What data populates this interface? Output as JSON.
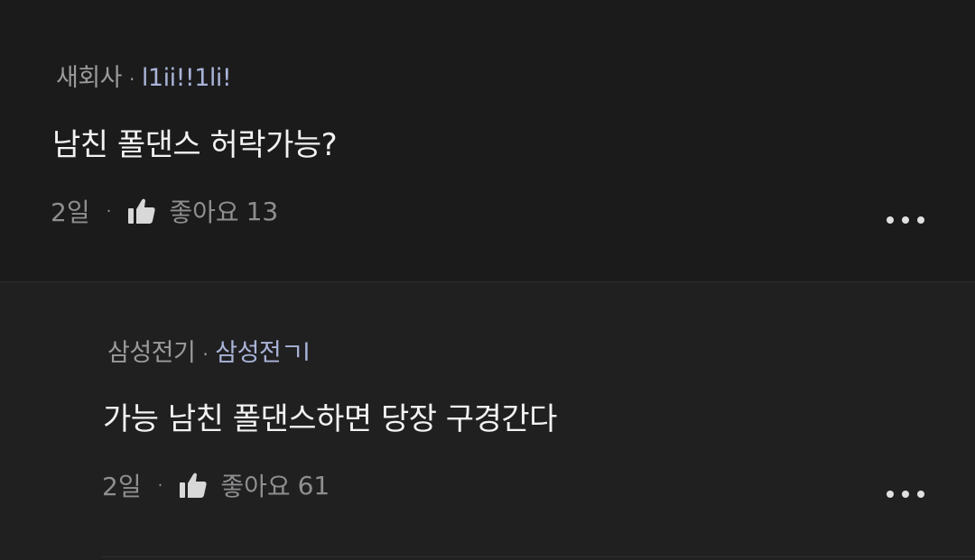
{
  "comments": [
    {
      "company": "새회사",
      "nickname": "l1ii!!1li!",
      "text": "남친 폴댄스 허락가능?",
      "time": "2일",
      "like_label": "좋아요",
      "like_count": "13"
    },
    {
      "company": "삼성전기",
      "nickname": "삼성전ㄱl",
      "text": "가능 남친 폴댄스하면 당장 구경간다",
      "time": "2일",
      "like_label": "좋아요",
      "like_count": "61"
    }
  ],
  "separator": "·",
  "icons": {
    "like": "thumbs-up-icon",
    "more": "more-horizontal-icon"
  },
  "colors": {
    "background": "#1b1b1c",
    "reply_background": "#202021",
    "text": "#f2f2f2",
    "meta": "#9b9b9d",
    "nickname": "#aab4d8"
  }
}
